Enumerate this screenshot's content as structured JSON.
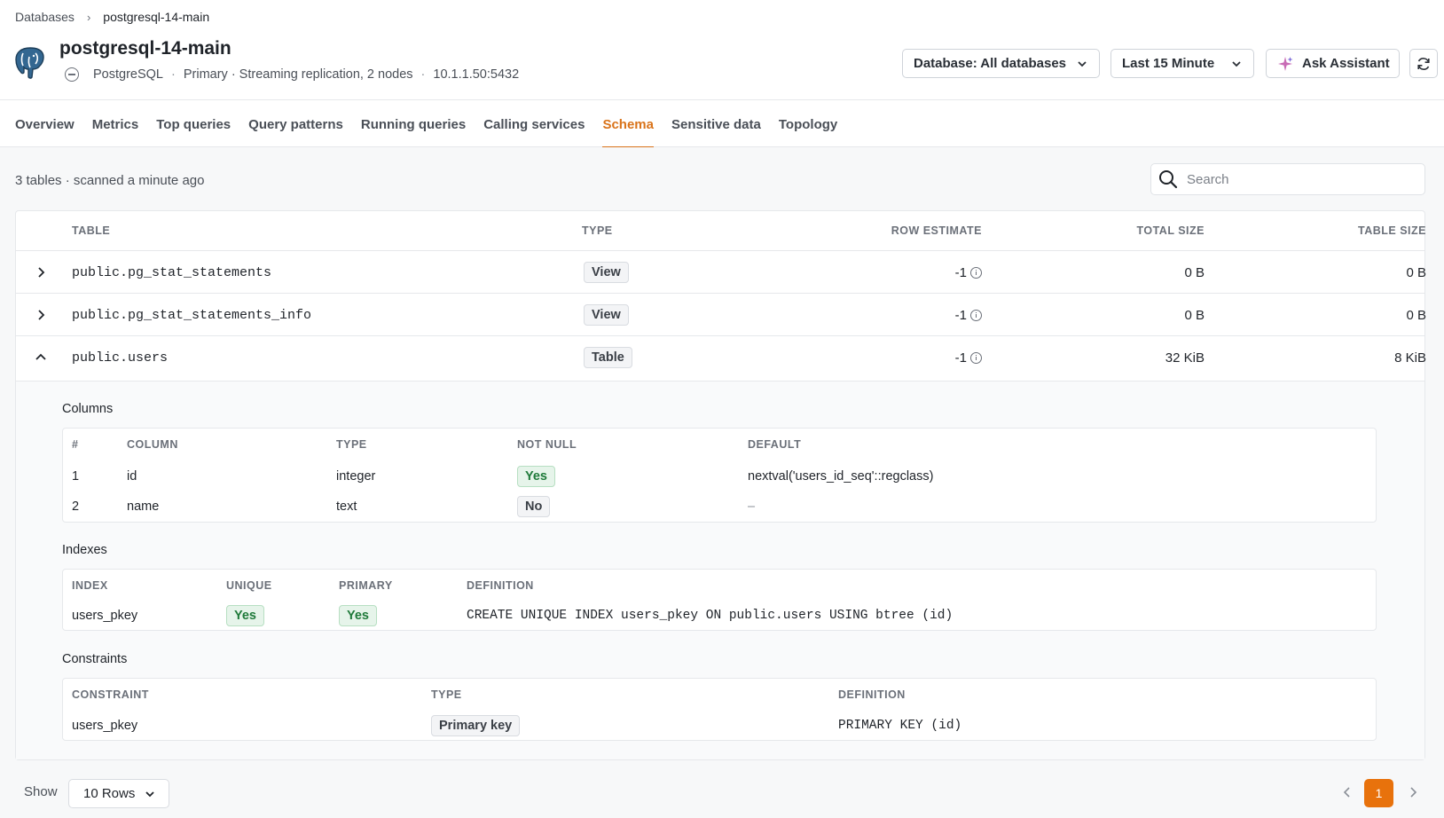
{
  "breadcrumb": {
    "root": "Databases",
    "current": "postgresql-14-main"
  },
  "header": {
    "title": "postgresql-14-main",
    "engine": "PostgreSQL",
    "role": "Primary · Streaming replication, 2 nodes",
    "address": "10.1.1.50:5432",
    "database_filter": "Database: All databases",
    "time_range": "Last 15 Minute",
    "assistant_label": "Ask Assistant"
  },
  "tabs": [
    "Overview",
    "Metrics",
    "Top queries",
    "Query patterns",
    "Running queries",
    "Calling services",
    "Schema",
    "Sensitive data",
    "Topology"
  ],
  "active_tab": "Schema",
  "summary": "3 tables · scanned a minute ago",
  "search": {
    "placeholder": "Search",
    "value": ""
  },
  "table": {
    "headers": {
      "table": "TABLE",
      "type": "TYPE",
      "rows": "ROW ESTIMATE",
      "total": "TOTAL SIZE",
      "size": "TABLE SIZE"
    },
    "rows": [
      {
        "name": "public.pg_stat_statements",
        "type": "View",
        "rows": "-1",
        "total": "0 B",
        "size": "0 B",
        "expanded": false
      },
      {
        "name": "public.pg_stat_statements_info",
        "type": "View",
        "rows": "-1",
        "total": "0 B",
        "size": "0 B",
        "expanded": false
      },
      {
        "name": "public.users",
        "type": "Table",
        "rows": "-1",
        "total": "32 KiB",
        "size": "8 KiB",
        "expanded": true
      }
    ]
  },
  "details": {
    "columns": {
      "title": "Columns",
      "headers": {
        "num": "#",
        "column": "COLUMN",
        "type": "TYPE",
        "not_null": "NOT NULL",
        "default": "DEFAULT"
      },
      "rows": [
        {
          "num": "1",
          "column": "id",
          "type": "integer",
          "not_null": "Yes",
          "default": "nextval('users_id_seq'::regclass)"
        },
        {
          "num": "2",
          "column": "name",
          "type": "text",
          "not_null": "No",
          "default": "–"
        }
      ]
    },
    "indexes": {
      "title": "Indexes",
      "headers": {
        "index": "INDEX",
        "unique": "UNIQUE",
        "primary": "PRIMARY",
        "definition": "DEFINITION"
      },
      "rows": [
        {
          "index": "users_pkey",
          "unique": "Yes",
          "primary": "Yes",
          "definition": "CREATE UNIQUE INDEX users_pkey ON public.users USING btree (id)"
        }
      ]
    },
    "constraints": {
      "title": "Constraints",
      "headers": {
        "constraint": "CONSTRAINT",
        "type": "TYPE",
        "definition": "DEFINITION"
      },
      "rows": [
        {
          "constraint": "users_pkey",
          "type": "Primary key",
          "definition": "PRIMARY KEY (id)"
        }
      ]
    }
  },
  "footer": {
    "show_label": "Show",
    "rows_per_page": "10 Rows",
    "page": "1"
  },
  "colors": {
    "accent": "#e8720c",
    "tab_active": "#d9731a",
    "success_bg": "#e6f4ea",
    "success_text": "#1f7a3a"
  }
}
